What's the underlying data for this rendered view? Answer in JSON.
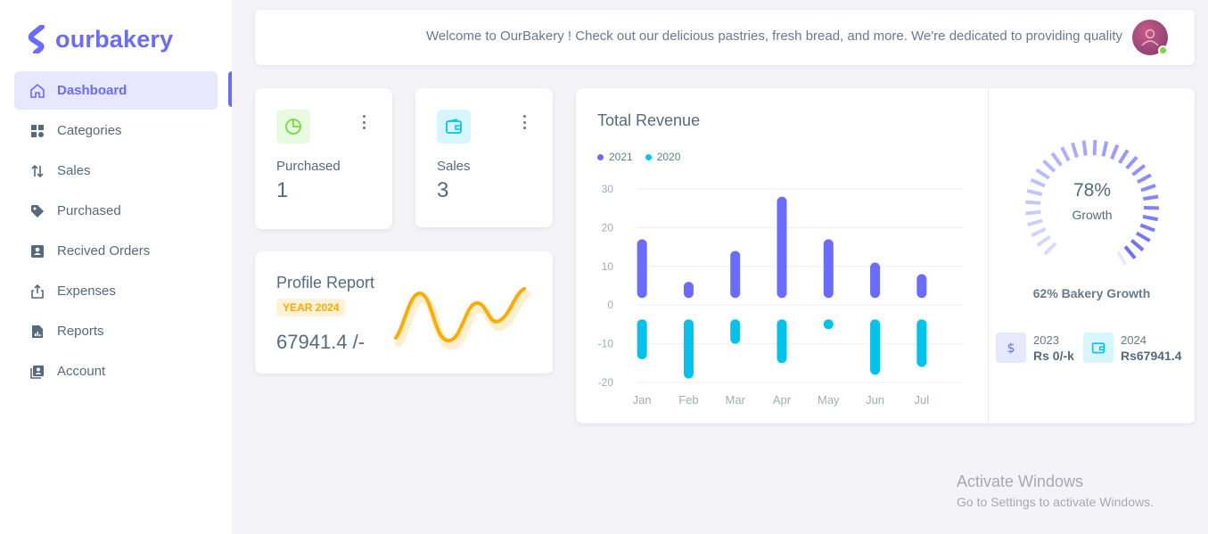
{
  "app": {
    "logo_text": "ourbakery"
  },
  "sidebar": {
    "items": [
      {
        "label": "Dashboard",
        "icon": "home-icon",
        "active": true
      },
      {
        "label": "Categories",
        "icon": "grid-icon"
      },
      {
        "label": "Sales",
        "icon": "sort-arrows-icon"
      },
      {
        "label": "Purchased",
        "icon": "tag-icon"
      },
      {
        "label": "Recived Orders",
        "icon": "contact-card-icon"
      },
      {
        "label": "Expenses",
        "icon": "export-icon"
      },
      {
        "label": "Reports",
        "icon": "report-file-icon"
      },
      {
        "label": "Account",
        "icon": "account-book-icon"
      }
    ]
  },
  "navbar": {
    "welcome": "Welcome to OurBakery ! Check out our delicious pastries, fresh bread, and more. We're dedicated to providing quality",
    "avatar_icon": "user-avatar-icon",
    "online": true
  },
  "stats": [
    {
      "label": "Purchased",
      "value": "1",
      "icon": "pie-chart-icon",
      "color": "#71dd37",
      "bg": "#e8fadf"
    },
    {
      "label": "Sales",
      "value": "3",
      "icon": "wallet-icon",
      "color": "#03c3ec",
      "bg": "#d7f5fc"
    }
  ],
  "profile_report": {
    "title": "Profile Report",
    "badge": "YEAR 2024",
    "value": "67941.4 /-",
    "line_color": "#ffab00"
  },
  "revenue": {
    "title": "Total Revenue",
    "growth": {
      "value": "78%",
      "label": "Growth",
      "percent": 78
    },
    "bakery_growth": "62% Bakery Growth",
    "years": [
      {
        "year": "2023",
        "value": "Rs 0/-k",
        "icon": "dollar-icon",
        "color": "#696cff",
        "bg": "#e7e7ff"
      },
      {
        "year": "2024",
        "value": "Rs67941.4",
        "icon": "wallet-icon",
        "color": "#03c3ec",
        "bg": "#d7f5fc"
      }
    ]
  },
  "chart_data": {
    "type": "bar",
    "title": "Total Revenue",
    "categories": [
      "Jan",
      "Feb",
      "Mar",
      "Apr",
      "May",
      "Jun",
      "Jul"
    ],
    "series": [
      {
        "name": "2021",
        "values": [
          17,
          6,
          14,
          28,
          17,
          11,
          8
        ],
        "color": "#696cff"
      },
      {
        "name": "2020",
        "values": [
          -14,
          -19,
          -10,
          -15,
          -5,
          -18,
          -16
        ],
        "color": "#03c3ec"
      }
    ],
    "ylim": [
      -20,
      30
    ],
    "yticks": [
      30,
      20,
      10,
      0,
      -10,
      -20
    ],
    "legend": "top-left",
    "grid": true
  },
  "watermark": {
    "line1": "Activate Windows",
    "line2": "Go to Settings to activate Windows."
  }
}
